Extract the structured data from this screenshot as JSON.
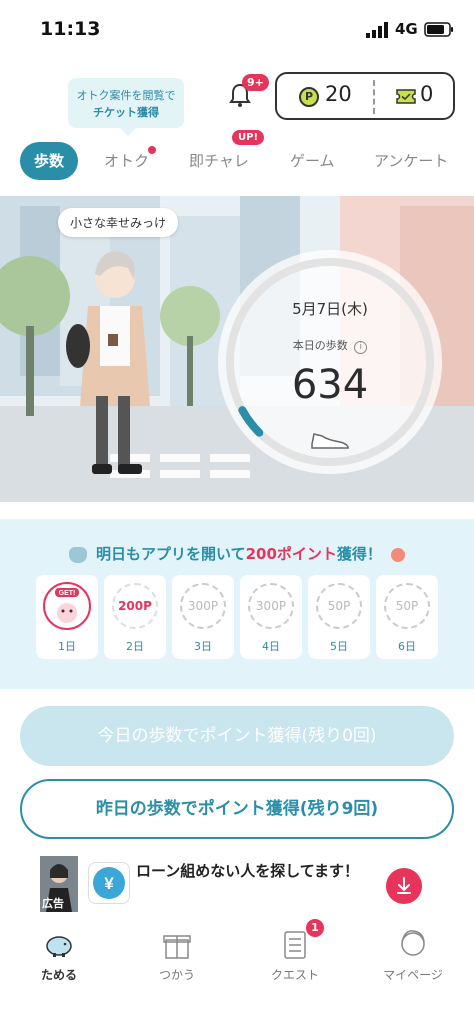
{
  "status_bar": {
    "time": "11:13",
    "network": "4G"
  },
  "header": {
    "tooltip_line1": "オトク案件を閲覧で",
    "tooltip_line2": "チケット獲得",
    "notification_badge": "9+",
    "points": "20",
    "tickets": "0",
    "points_icon_letter": "P"
  },
  "tabs": [
    {
      "label": "歩数",
      "active": true
    },
    {
      "label": "オトク"
    },
    {
      "label": "即チャレ",
      "badge": "UP!"
    },
    {
      "label": "ゲーム"
    },
    {
      "label": "アンケート"
    }
  ],
  "hero": {
    "bubble": "小さな幸せみっけ",
    "date": "5月7日(木)",
    "steps_label": "本日の歩数",
    "steps": "634",
    "steps_progress": 0.06
  },
  "streak": {
    "title_pre": "明日もアプリを開いて",
    "title_points": "200ポイント",
    "title_post": "獲得！",
    "days": [
      {
        "reward": "GET!",
        "day": "1日"
      },
      {
        "reward": "200P",
        "day": "2日"
      },
      {
        "reward": "300P",
        "day": "3日"
      },
      {
        "reward": "300P",
        "day": "4日"
      },
      {
        "reward": "50P",
        "day": "5日"
      },
      {
        "reward": "50P",
        "day": "6日"
      }
    ]
  },
  "buttons": {
    "today": "今日の歩数でポイント獲得(残り0回)",
    "yesterday": "昨日の歩数でポイント獲得(残り9回)"
  },
  "ad": {
    "label": "広告",
    "text": "ローン組めない人を探してます！"
  },
  "bottom_nav": [
    {
      "label": "ためる",
      "active": true
    },
    {
      "label": "つかう"
    },
    {
      "label": "クエスト",
      "badge": "1"
    },
    {
      "label": "マイページ"
    }
  ],
  "colors": {
    "accent": "#2a8ea9",
    "alert": "#e8335a",
    "points_green": "#c7df4b"
  }
}
